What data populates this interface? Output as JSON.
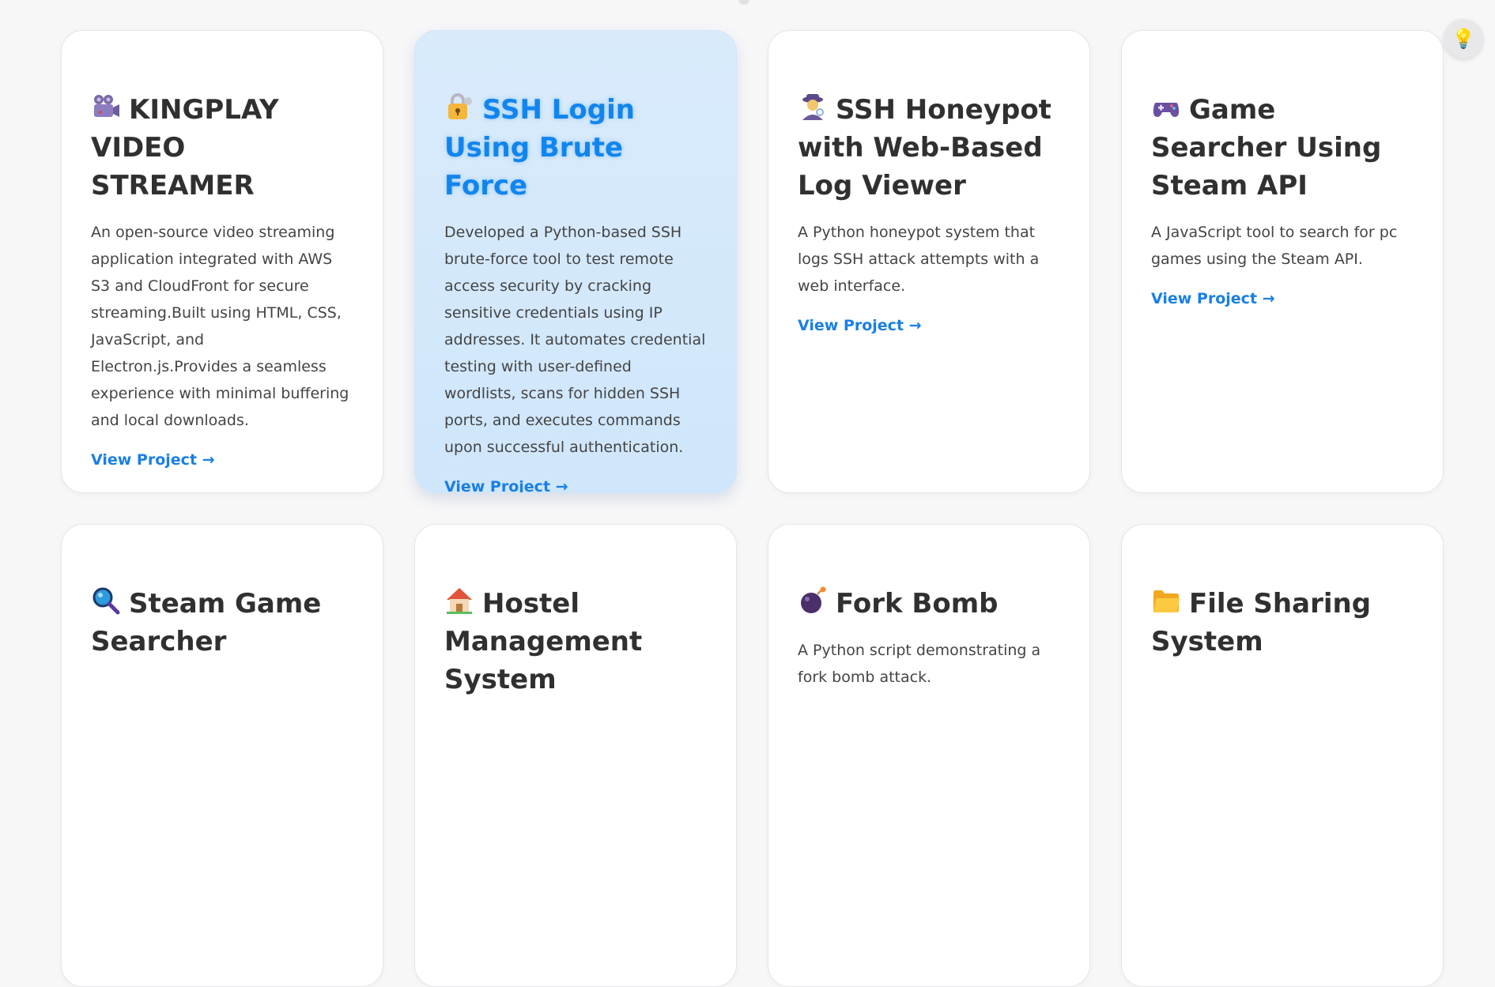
{
  "projects": [
    {
      "icon": "film-camera-icon",
      "title": "KINGPLAY VIDEO STREAMER",
      "description": "An open-source video streaming application integrated with AWS S3 and CloudFront for secure streaming.Built using HTML, CSS, JavaScript, and Electron.js.Provides a seamless experience with minimal buffering and local downloads.",
      "link": "View Project →"
    },
    {
      "icon": "locked-key-icon",
      "title": "SSH Login Using Brute Force",
      "description": "Developed a Python-based SSH brute-force tool to test remote access security by cracking sensitive credentials using IP addresses. It automates credential testing with user-defined wordlists, scans for hidden SSH ports, and executes commands upon successful authentication.",
      "link": "View Project →"
    },
    {
      "icon": "detective-icon",
      "title": "SSH Honeypot with Web-Based Log Viewer",
      "description": "A Python honeypot system that logs SSH attack attempts with a web interface.",
      "link": "View Project →"
    },
    {
      "icon": "game-controller-icon",
      "title": "Game Searcher Using Steam API",
      "description": "A JavaScript tool to search for pc games using the Steam API.",
      "link": "View Project →"
    },
    {
      "icon": "magnifier-icon",
      "title": "Steam Game Searcher",
      "description": "",
      "link": ""
    },
    {
      "icon": "house-icon",
      "title": "Hostel Management System",
      "description": "",
      "link": ""
    },
    {
      "icon": "bomb-icon",
      "title": "Fork Bomb",
      "description": "A Python script demonstrating a fork bomb attack.",
      "link": ""
    },
    {
      "icon": "folder-icon",
      "title": "File Sharing System",
      "description": "",
      "link": ""
    }
  ],
  "theme_toggle": {
    "icon": "lightbulb-icon",
    "glyph": "💡"
  },
  "colors": {
    "accent": "#1a7fe3",
    "highlight_bg": "#d4e8fb",
    "page_bg": "#f7f7f8"
  }
}
